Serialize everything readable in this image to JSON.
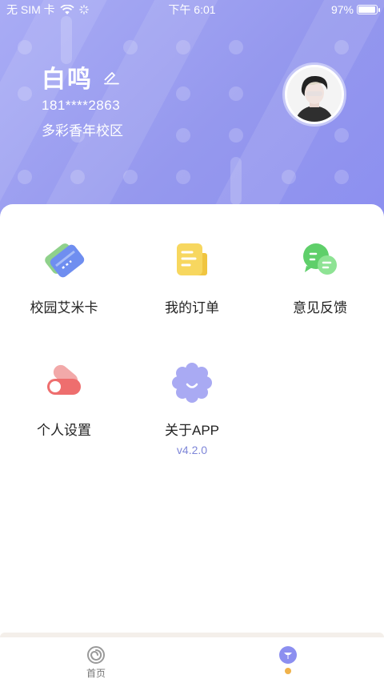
{
  "status_bar": {
    "carrier": "无 SIM 卡",
    "time": "下午 6:01",
    "battery": "97%",
    "battery_level": 0.97
  },
  "profile": {
    "name": "白鸣",
    "phone": "181****2863",
    "campus": "多彩香年校区"
  },
  "menu": {
    "card": {
      "label": "校园艾米卡"
    },
    "orders": {
      "label": "我的订单"
    },
    "feedback": {
      "label": "意见反馈"
    },
    "settings": {
      "label": "个人设置"
    },
    "about": {
      "label": "关于APP",
      "version": "v4.2.0"
    }
  },
  "tabs": {
    "home": {
      "label": "首页"
    }
  },
  "colors": {
    "header": "#9598ee",
    "accent": "#7e86d8",
    "tab_dot": "#f0b24a"
  }
}
